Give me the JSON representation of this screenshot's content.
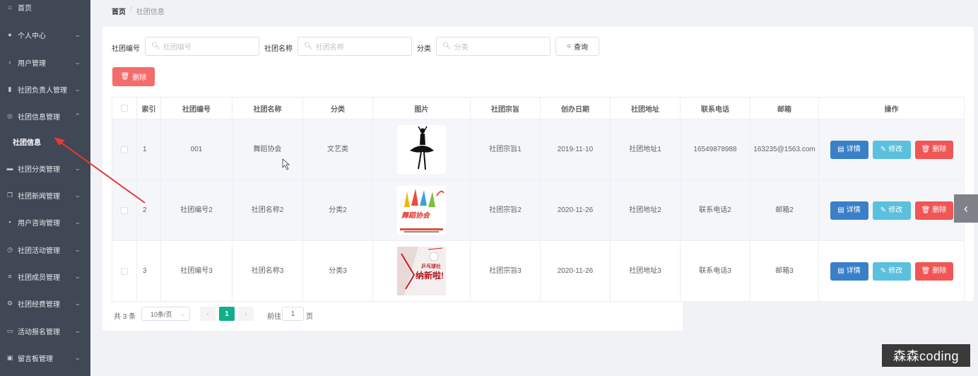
{
  "sidebar": {
    "items": [
      {
        "label": "首页",
        "icon": "home-icon"
      },
      {
        "label": "个人中心",
        "icon": "user-icon"
      },
      {
        "label": "用户管理",
        "icon": "mic-icon"
      },
      {
        "label": "社团负责人管理",
        "icon": "bar-chart-icon"
      },
      {
        "label": "社团信息管理",
        "icon": "globe-icon"
      },
      {
        "label": "社团信息"
      },
      {
        "label": "社团分类管理",
        "icon": "monitor-icon"
      },
      {
        "label": "社团新闻管理",
        "icon": "copy-icon"
      },
      {
        "label": "用户咨询管理",
        "icon": "chat-icon"
      },
      {
        "label": "社团活动管理",
        "icon": "clock-icon"
      },
      {
        "label": "社团成员管理",
        "icon": "list-icon"
      },
      {
        "label": "社团经费管理",
        "icon": "gear-icon"
      },
      {
        "label": "活动报名管理",
        "icon": "message-icon"
      },
      {
        "label": "留言板管理",
        "icon": "box-icon"
      }
    ]
  },
  "breadcrumb": {
    "home": "首页",
    "sep": "/",
    "current": "社团信息"
  },
  "filters": {
    "id_label": "社团编号",
    "id_placeholder": "社团编号",
    "name_label": "社团名称",
    "name_placeholder": "社团名称",
    "category_label": "分类",
    "category_placeholder": "分类",
    "query_button": "查询"
  },
  "delete_button": "删除",
  "table": {
    "headers": [
      "索引",
      "社团编号",
      "社团名称",
      "分类",
      "图片",
      "社团宗旨",
      "创办日期",
      "社团地址",
      "联系电话",
      "邮箱",
      "操作"
    ],
    "rows": [
      {
        "index": "1",
        "code": "001",
        "name": "舞蹈协会",
        "category": "文艺类",
        "purpose": "社团宗旨1",
        "date": "2019-11-10",
        "address": "社团地址1",
        "phone": "16549878988",
        "email": "163235@1563.com"
      },
      {
        "index": "2",
        "code": "社团编号2",
        "name": "社团名称2",
        "category": "分类2",
        "purpose": "社团宗旨2",
        "date": "2020-11-26",
        "address": "社团地址2",
        "phone": "联系电话2",
        "email": "邮箱2"
      },
      {
        "index": "3",
        "code": "社团编号3",
        "name": "社团名称3",
        "category": "分类3",
        "purpose": "社团宗旨3",
        "date": "2020-11-26",
        "address": "社团地址3",
        "phone": "联系电话3",
        "email": "邮箱3"
      }
    ],
    "actions": {
      "detail": "详情",
      "edit": "修改",
      "delete": "删除"
    }
  },
  "thumb_text": {
    "row2": "舞蹈协会",
    "row3_top": "乒乓球社",
    "row3_main": "纳新啦!"
  },
  "pagination": {
    "total": "共 3 条",
    "page_size": "10条/页",
    "current_page": "1",
    "goto_prefix": "前往",
    "goto_value": "1",
    "goto_suffix": "页"
  },
  "watermark": "森森coding",
  "colors": {
    "sidebar_bg": "#404755",
    "accent": "#13ae8a",
    "danger": "#f56c6c",
    "detail": "#3a80c8",
    "edit": "#5bc0de"
  }
}
